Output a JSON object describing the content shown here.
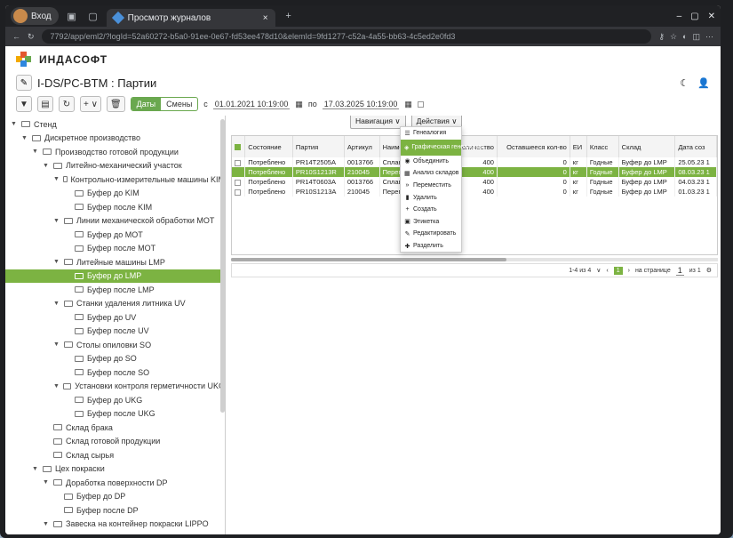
{
  "browser": {
    "profile_label": "Вход",
    "tab_title": "Просмотр журналов",
    "new_tab": "+",
    "close_tab": "×",
    "url": "7792/app/eml2/?logId=52a60272-b5a0-91ee-0e67-fd53ee478d10&elemId=9fd1277-c52a-4a55-bb63-4c5ed2e0fd3"
  },
  "app": {
    "brand": "ИНДАСОФТ",
    "title": "I-DS/PC-BTM : Партии",
    "toolbar": {
      "add": "+",
      "add_caret": "∨",
      "tab_dates": "Даты",
      "tab_shifts": "Смены",
      "from_prefix": "с",
      "from_date": "01.01.2021 10:19:00",
      "to_prefix": "по",
      "to_date": "17.03.2025 10:19:00"
    },
    "menus": {
      "navigation": "Навигация",
      "actions": "Действия"
    },
    "topright": {
      "theme_icon": "moon-icon",
      "user_icon": "user-icon"
    }
  },
  "tree": [
    {
      "label": "Стенд",
      "level": 0,
      "expanded": true
    },
    {
      "label": "Дискретное производство",
      "level": 1,
      "expanded": true
    },
    {
      "label": "Производство готовой продукции",
      "level": 2,
      "expanded": true
    },
    {
      "label": "Литейно-механический участок",
      "level": 3,
      "expanded": true
    },
    {
      "label": "Контрольно-измерительные машины KIM",
      "level": 4,
      "expanded": true
    },
    {
      "label": "Буфер до KIM",
      "level": 5
    },
    {
      "label": "Буфер после KIM",
      "level": 5
    },
    {
      "label": "Линии механической обработки MOT",
      "level": 4,
      "expanded": true
    },
    {
      "label": "Буфер до MOT",
      "level": 5
    },
    {
      "label": "Буфер после MOT",
      "level": 5
    },
    {
      "label": "Литейные машины LMP",
      "level": 4,
      "expanded": true
    },
    {
      "label": "Буфер до LMP",
      "level": 5,
      "selected": true
    },
    {
      "label": "Буфер после LMP",
      "level": 5
    },
    {
      "label": "Станки удаления литника UV",
      "level": 4,
      "expanded": true
    },
    {
      "label": "Буфер до UV",
      "level": 5
    },
    {
      "label": "Буфер после UV",
      "level": 5
    },
    {
      "label": "Столы опиловки SO",
      "level": 4,
      "expanded": true
    },
    {
      "label": "Буфер до SO",
      "level": 5
    },
    {
      "label": "Буфер после SO",
      "level": 5
    },
    {
      "label": "Установки контроля герметичности UKG",
      "level": 4,
      "expanded": true
    },
    {
      "label": "Буфер до UKG",
      "level": 5
    },
    {
      "label": "Буфер после UKG",
      "level": 5
    },
    {
      "label": "Склад брака",
      "level": 3
    },
    {
      "label": "Склад готовой продукции",
      "level": 3
    },
    {
      "label": "Склад сырья",
      "level": 3
    },
    {
      "label": "Цех покраски",
      "level": 2,
      "expanded": true
    },
    {
      "label": "Доработка поверхности DP",
      "level": 3,
      "expanded": true
    },
    {
      "label": "Буфер до DP",
      "level": 4
    },
    {
      "label": "Буфер после DP",
      "level": 4
    },
    {
      "label": "Завеска на контейнер покраски LIPPO",
      "level": 3,
      "expanded": true
    }
  ],
  "table": {
    "headers": [
      "Состояние",
      "Партия",
      "Артикул",
      "Наимен",
      "мала",
      "Количество",
      "Оставшееся кол-во",
      "ЕИ",
      "Класс",
      "Склад",
      "Дата соз"
    ],
    "rows": [
      {
        "checked": false,
        "highlight": false,
        "cells": [
          "Потреблено",
          "PR14T2505A",
          "0013766",
          "Сплав АТ",
          "",
          "400",
          "0",
          "кг",
          "Годные",
          "Буфер до LMP",
          "25.05.23 1"
        ]
      },
      {
        "checked": true,
        "highlight": true,
        "cells": [
          "Потреблено",
          "PR10S1213R",
          "210045",
          "Переплав А",
          "ллан",
          "400",
          "0",
          "кг",
          "Годные",
          "Буфер до LMP",
          "08.03.23 1"
        ]
      },
      {
        "checked": false,
        "highlight": false,
        "cells": [
          "Потреблено",
          "PR14T0603A",
          "0013766",
          "Сплав АТ",
          "а",
          "400",
          "0",
          "кг",
          "Годные",
          "Буфер до LMP",
          "04.03.23 1"
        ]
      },
      {
        "checked": false,
        "highlight": false,
        "cells": [
          "Потреблено",
          "PR10S1213A",
          "210045",
          "Переплав А",
          "лав",
          "400",
          "0",
          "кг",
          "Годные",
          "Буфер до LMP",
          "01.03.23 1"
        ]
      }
    ]
  },
  "actions_menu": [
    {
      "label": "Генеалогия",
      "icon": "genealogy-icon",
      "glyph": "☰"
    },
    {
      "label": "Графическая генеалогия",
      "icon": "graph-genealogy-icon",
      "glyph": "◈",
      "hover": true
    },
    {
      "label": "Объединить",
      "icon": "merge-icon",
      "glyph": "◉"
    },
    {
      "label": "Анализ складов",
      "icon": "warehouse-analysis-icon",
      "glyph": "▦"
    },
    {
      "label": "Переместить",
      "icon": "move-icon",
      "glyph": "»"
    },
    {
      "label": "Удалить",
      "icon": "delete-icon",
      "glyph": "▮"
    },
    {
      "label": "Создать",
      "icon": "create-icon",
      "glyph": "+"
    },
    {
      "label": "Этикетка",
      "icon": "label-icon",
      "glyph": "▣"
    },
    {
      "label": "Редактировать",
      "icon": "edit-icon",
      "glyph": "✎"
    },
    {
      "label": "Разделить",
      "icon": "split-icon",
      "glyph": "✚"
    }
  ],
  "pager": {
    "range": "1-4 из 4",
    "page": "1",
    "per_page_label": "на странице",
    "per_page_value": "1",
    "of_label": "из 1"
  }
}
